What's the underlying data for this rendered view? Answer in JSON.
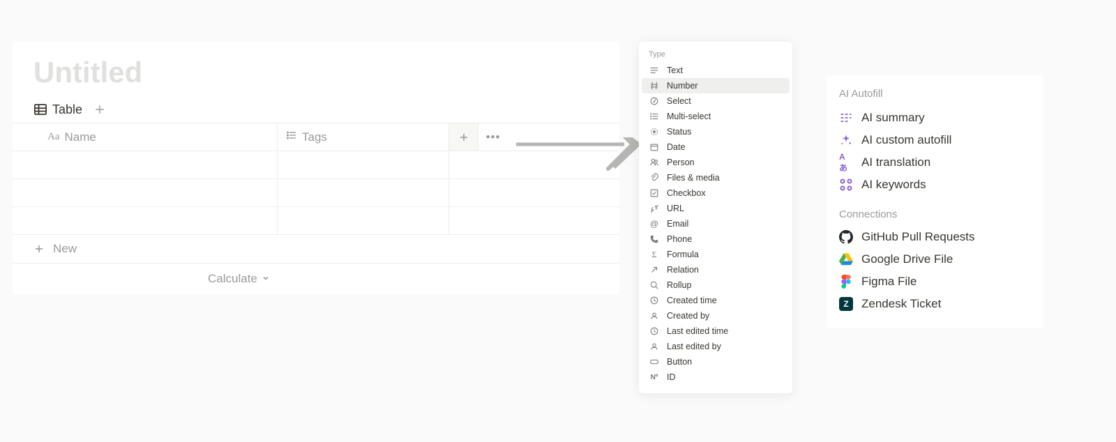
{
  "page": {
    "title_placeholder": "Untitled"
  },
  "tabs": {
    "table_label": "Table"
  },
  "columns": {
    "name_label": "Name",
    "tags_label": "Tags"
  },
  "actions": {
    "new_label": "New",
    "calculate_label": "Calculate"
  },
  "type_menu": {
    "header": "Type",
    "items": [
      {
        "id": "text",
        "label": "Text",
        "highlighted": false
      },
      {
        "id": "number",
        "label": "Number",
        "highlighted": true
      },
      {
        "id": "select",
        "label": "Select",
        "highlighted": false
      },
      {
        "id": "multi-select",
        "label": "Multi-select",
        "highlighted": false
      },
      {
        "id": "status",
        "label": "Status",
        "highlighted": false
      },
      {
        "id": "date",
        "label": "Date",
        "highlighted": false
      },
      {
        "id": "person",
        "label": "Person",
        "highlighted": false
      },
      {
        "id": "files-media",
        "label": "Files & media",
        "highlighted": false
      },
      {
        "id": "checkbox",
        "label": "Checkbox",
        "highlighted": false
      },
      {
        "id": "url",
        "label": "URL",
        "highlighted": false
      },
      {
        "id": "email",
        "label": "Email",
        "highlighted": false
      },
      {
        "id": "phone",
        "label": "Phone",
        "highlighted": false
      },
      {
        "id": "formula",
        "label": "Formula",
        "highlighted": false
      },
      {
        "id": "relation",
        "label": "Relation",
        "highlighted": false
      },
      {
        "id": "rollup",
        "label": "Rollup",
        "highlighted": false
      },
      {
        "id": "created-time",
        "label": "Created time",
        "highlighted": false
      },
      {
        "id": "created-by",
        "label": "Created by",
        "highlighted": false
      },
      {
        "id": "last-edited-time",
        "label": "Last edited time",
        "highlighted": false
      },
      {
        "id": "last-edited-by",
        "label": "Last edited by",
        "highlighted": false
      },
      {
        "id": "button",
        "label": "Button",
        "highlighted": false
      },
      {
        "id": "id",
        "label": "ID",
        "highlighted": false
      }
    ]
  },
  "ai_panel": {
    "autofill_header": "AI Autofill",
    "autofill_items": [
      {
        "id": "summary",
        "label": "AI summary"
      },
      {
        "id": "custom",
        "label": "AI custom autofill"
      },
      {
        "id": "translation",
        "label": "AI translation"
      },
      {
        "id": "keywords",
        "label": "AI keywords"
      }
    ],
    "connections_header": "Connections",
    "connections": [
      {
        "id": "github",
        "label": "GitHub Pull Requests"
      },
      {
        "id": "gdrive",
        "label": "Google Drive File"
      },
      {
        "id": "figma",
        "label": "Figma File"
      },
      {
        "id": "zendesk",
        "label": "Zendesk Ticket"
      }
    ]
  }
}
